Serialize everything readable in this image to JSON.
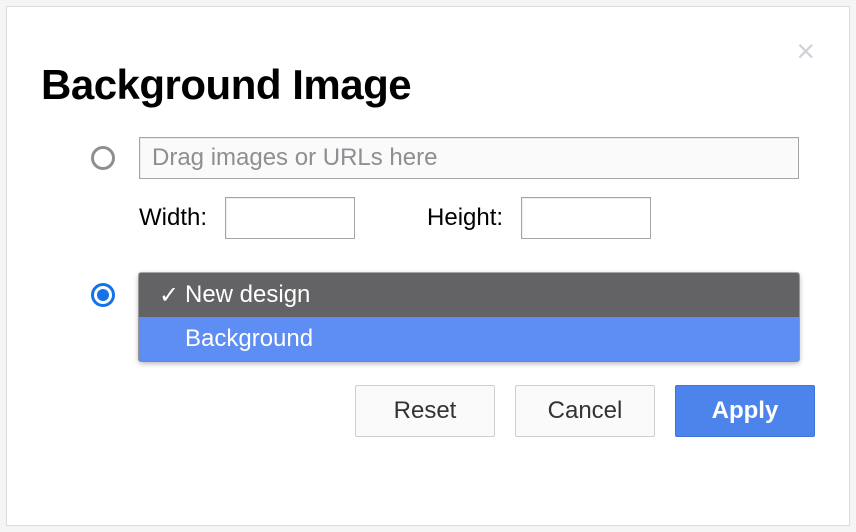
{
  "dialog": {
    "title": "Background Image",
    "close_icon": "×"
  },
  "dropzone": {
    "placeholder": "Drag images or URLs here"
  },
  "dimensions": {
    "width_label": "Width:",
    "height_label": "Height:",
    "width_value": "",
    "height_value": ""
  },
  "select": {
    "options": [
      {
        "label": "New design",
        "checked": true
      },
      {
        "label": "Background",
        "checked": false
      }
    ]
  },
  "buttons": {
    "reset": "Reset",
    "cancel": "Cancel",
    "apply": "Apply"
  }
}
